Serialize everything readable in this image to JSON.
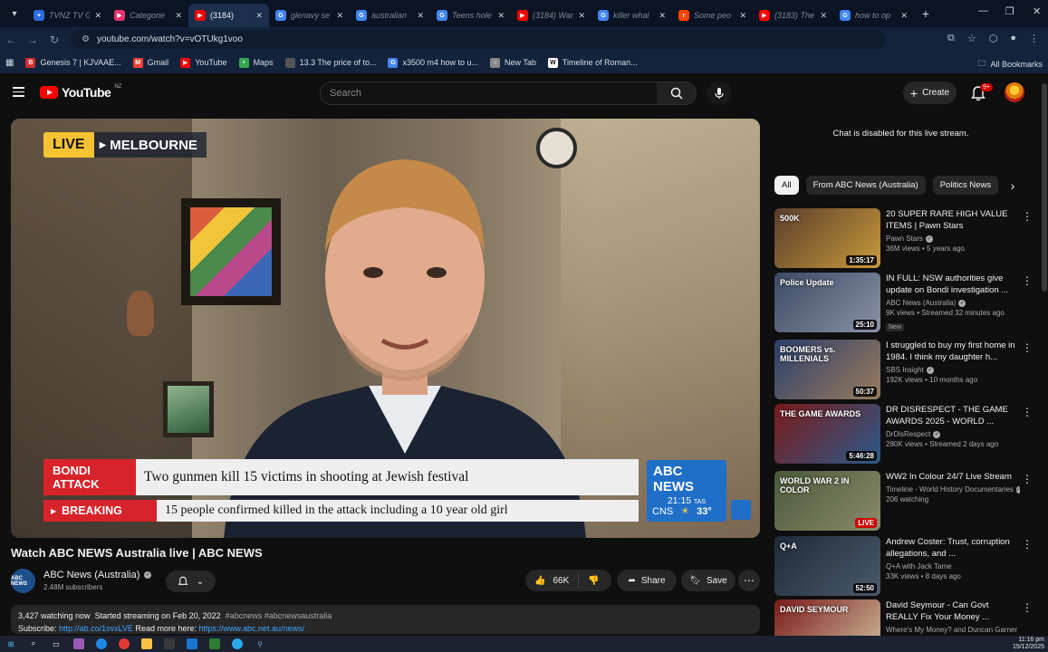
{
  "browser": {
    "tabs": [
      {
        "title": "TVNZ TV G",
        "fav_color": "#2d6cdf",
        "fav_glyph": "+"
      },
      {
        "title": "Categorie",
        "fav_color": "#e8336d",
        "fav_glyph": "▶"
      },
      {
        "title": "(3184)",
        "fav_color": "#ff0000",
        "fav_glyph": "▶",
        "active": true
      },
      {
        "title": "glenavy se",
        "fav_color": "#4285f4",
        "fav_glyph": "G"
      },
      {
        "title": "australian",
        "fav_color": "#4285f4",
        "fav_glyph": "G"
      },
      {
        "title": "Teens hole",
        "fav_color": "#4285f4",
        "fav_glyph": "G"
      },
      {
        "title": "(3184) War",
        "fav_color": "#ff0000",
        "fav_glyph": "▶"
      },
      {
        "title": "killer whal",
        "fav_color": "#4285f4",
        "fav_glyph": "G"
      },
      {
        "title": "Some peo",
        "fav_color": "#ff4500",
        "fav_glyph": "r"
      },
      {
        "title": "(3183) The",
        "fav_color": "#ff0000",
        "fav_glyph": "▶"
      },
      {
        "title": "how to op",
        "fav_color": "#4285f4",
        "fav_glyph": "G"
      }
    ],
    "url": "youtube.com/watch?v=vOTUkg1voo",
    "bookmarks": [
      {
        "label": "Genesis 7 | KJVAAE...",
        "color": "#d32f2f",
        "glyph": "B"
      },
      {
        "label": "Gmail",
        "color": "#ea4335",
        "glyph": "M"
      },
      {
        "label": "YouTube",
        "color": "#ff0000",
        "glyph": "▶"
      },
      {
        "label": "Maps",
        "color": "#34a853",
        "glyph": "•"
      },
      {
        "label": "13.3 The price of to...",
        "color": "#555555",
        "glyph": ""
      },
      {
        "label": "x3500 m4 how to u...",
        "color": "#4285f4",
        "glyph": "G"
      },
      {
        "label": "New Tab",
        "color": "#888888",
        "glyph": "○"
      },
      {
        "label": "Timeline of Roman...",
        "color": "#ffffff",
        "glyph": "W"
      }
    ],
    "all_bookmarks": "All Bookmarks"
  },
  "yt": {
    "logo_word": "YouTube",
    "country": "NZ",
    "search_placeholder": "Search",
    "create_label": "Create",
    "notif_count": "9+"
  },
  "video": {
    "live_label": "LIVE",
    "location": "MELBOURNE",
    "ticker_tag": "BONDI ATTACK",
    "ticker_headline": "Two gunmen kill 15 victims in shooting at Jewish festival",
    "breaking_label": "BREAKING",
    "breaking_text": "15 people confirmed killed in the attack including a 10 year old girl",
    "network": "ABC NEWS",
    "clock": "21:15",
    "tz": "TAS",
    "city": "CNS",
    "temp": "33°"
  },
  "info": {
    "title": "Watch ABC NEWS Australia live | ABC NEWS",
    "channel": "ABC News (Australia)",
    "channel_avatar": "ABC NEWS",
    "subscribers": "2.48M subscribers",
    "likes": "66K",
    "share_label": "Share",
    "save_label": "Save",
    "watching": "3,427 watching now",
    "started": "Started streaming on Feb 20, 2022",
    "tags": "#abcnews #abcnewsaustralia",
    "subscribe_prefix": "Subscribe:",
    "subscribe_link": "http://ab.co/1svxLVE",
    "read_more_prefix": "Read more here:",
    "read_more_link": "https://www.abc.net.au/news/"
  },
  "sidebar": {
    "chat_disabled": "Chat is disabled for this live stream.",
    "chips": [
      "All",
      "From ABC News (Australia)",
      "Politics News"
    ],
    "recs": [
      {
        "title": "20 SUPER RARE HIGH VALUE ITEMS | Pawn Stars",
        "channel": "Pawn Stars",
        "stats": "36M views • 5 years ago",
        "duration": "1:35:17",
        "thumb": [
          "#5a3e2c",
          "#c99a3b"
        ],
        "thumb_text": "500K",
        "new": ""
      },
      {
        "title": "IN FULL: NSW authorities give update on Bondi investigation ...",
        "channel": "ABC News (Australia)",
        "stats": "9K views • Streamed 32 minutes ago",
        "duration": "25:10",
        "thumb": [
          "#3b4a63",
          "#8a92a8"
        ],
        "thumb_text": "Police Update",
        "new": "New"
      },
      {
        "title": "I struggled to buy my first home in 1984. I think my daughter h...",
        "channel": "SBS Insight",
        "stats": "192K views • 10 months ago",
        "duration": "50:37",
        "thumb": [
          "#2b3f6b",
          "#9a7b5d"
        ],
        "thumb_text": "BOOMERS vs. MILLENIALS",
        "new": ""
      },
      {
        "title": "DR DISRESPECT - THE GAME AWARDS 2025 - WORLD ...",
        "channel": "DrDisRespect",
        "stats": "280K views • Streamed 2 days ago",
        "duration": "5:46:28",
        "thumb": [
          "#7a1a1a",
          "#2a5a8a"
        ],
        "thumb_text": "THE GAME AWARDS",
        "new": ""
      },
      {
        "title": "WW2 In Colour 24/7 Live Stream",
        "channel": "Timeline - World History Documentaries",
        "stats": "206 watching",
        "duration": "LIVE",
        "thumb": [
          "#4a5a3a",
          "#8a8a6a"
        ],
        "thumb_text": "WORLD WAR 2 IN COLOR",
        "new": "",
        "live": true
      },
      {
        "title": "Andrew Coster: Trust, corruption allegations, and ...",
        "channel": "Q+A with Jack Tame",
        "stats": "33K views • 8 days ago",
        "duration": "52:50",
        "thumb": [
          "#1e2a3a",
          "#4a5a6a"
        ],
        "thumb_text": "Q+A",
        "new": ""
      },
      {
        "title": "David Seymour - Can Govt REALLY Fix Your Money ...",
        "channel": "Where's My Money? and Duncan Garner",
        "stats": "",
        "duration": "",
        "thumb": [
          "#7a1a1a",
          "#d0c0a0"
        ],
        "thumb_text": "DAVID SEYMOUR",
        "new": ""
      }
    ]
  },
  "taskbar": {
    "time": "11:16 pm",
    "date": "15/12/2025"
  }
}
